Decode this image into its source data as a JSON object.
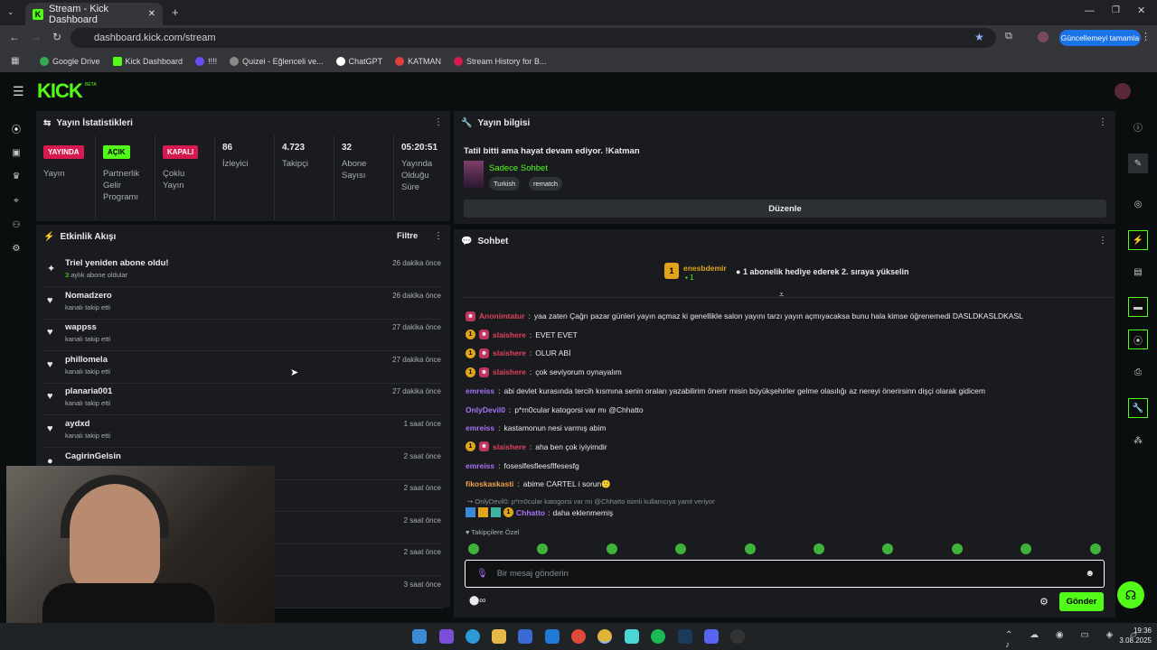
{
  "browser": {
    "tab_title": "Stream - Kick Dashboard",
    "url": "dashboard.kick.com/stream",
    "update_label": "Güncellemeyi tamamla",
    "bookmarks": [
      "Google Drive",
      "Kick Dashboard",
      "!!!!",
      "Quizei - Eğlenceli ve...",
      "ChatGPT",
      "KATMAN",
      "Stream History for B..."
    ]
  },
  "app": {
    "logo": "KICK",
    "beta": "BETA"
  },
  "stats": {
    "title": "Yayın İstatistikleri",
    "items": [
      {
        "badge": "YAYINDA",
        "label": "Yayın"
      },
      {
        "badge": "AÇIK",
        "label": "Partnerlik Gelir Programı"
      },
      {
        "badge": "KAPALI",
        "label": "Çoklu Yayın"
      },
      {
        "value": "86",
        "label": "İzleyici"
      },
      {
        "value": "4.723",
        "label": "Takipçi"
      },
      {
        "value": "32",
        "label": "Abone Sayısı"
      },
      {
        "value": "05:20:51",
        "label": "Yayında Olduğu Süre"
      }
    ]
  },
  "activity": {
    "title": "Etkinlik Akışı",
    "filter": "Filtre",
    "items": [
      {
        "name": "Triel yeniden abone oldu!",
        "sub_num": "3",
        "sub": " aylık abone oldular",
        "time": "26 dakika önce",
        "icon": "✦"
      },
      {
        "name": "Nomadzero",
        "sub": "kanalı takip etti",
        "time": "26 dakika önce",
        "icon": "♥"
      },
      {
        "name": "wappss",
        "sub": "kanalı takip etti",
        "time": "27 dakika önce",
        "icon": "♥"
      },
      {
        "name": "phillomela",
        "sub": "kanalı takip etti",
        "time": "27 dakika önce",
        "icon": "♥"
      },
      {
        "name": "planaria001",
        "sub": "kanalı takip etti",
        "time": "27 dakika önce",
        "icon": "♥"
      },
      {
        "name": "aydxd",
        "sub": "kanalı takip etti",
        "time": "1 saat önce",
        "icon": "♥"
      },
      {
        "name": "CagirinGelsin",
        "sub": "",
        "time": "2 saat önce",
        "icon": "●"
      },
      {
        "name": "",
        "sub": "",
        "time": "2 saat önce",
        "icon": ""
      },
      {
        "name": "",
        "sub": "",
        "time": "2 saat önce",
        "icon": ""
      },
      {
        "name": "",
        "sub": "",
        "time": "2 saat önce",
        "icon": ""
      },
      {
        "name": "",
        "sub": "",
        "time": "3 saat önce",
        "icon": ""
      }
    ]
  },
  "stream_info": {
    "title": "Yayın bilgisi",
    "stream_title": "Tatil bitti ama hayat devam ediyor. !Katman",
    "category": "Sadece Sohbet",
    "tags": [
      "Turkish",
      "rematch"
    ],
    "edit_label": "Düzenle"
  },
  "chat": {
    "title": "Sohbet",
    "pinned_user": "enesbdemir",
    "pinned_count": "1",
    "pinned_rank": "1",
    "pinned_text": "1 abonelik hediye ederek 2. sıraya yükselin",
    "messages": [
      {
        "user": "Anonimtatur",
        "color": "#e0435b",
        "text": "yaa zaten Çağrı pazar günleri yayın açmaz ki genellikle salon yayını tarzı yayın açmıyacaksa bunu hala kimse öğrenemedi DASLDKASLDKASL",
        "badges": [
          "sub"
        ]
      },
      {
        "user": "slaishere",
        "color": "#e0435b",
        "text": "EVET EVET",
        "badges": [
          "gift",
          "sub"
        ]
      },
      {
        "user": "slaishere",
        "color": "#e0435b",
        "text": "OLUR ABİ",
        "badges": [
          "gift",
          "sub"
        ]
      },
      {
        "user": "slaishere",
        "color": "#e0435b",
        "text": "çok seviyorum oynayalım",
        "badges": [
          "gift",
          "sub"
        ]
      },
      {
        "user": "emreiss",
        "color": "#a971f5",
        "text": "abi devlet kurasında tercih kısmına senin oraları yazabilirim önerir misin büyükşehirler gelme olasılığı az nereyi önerirsinn dişçi olarak gidicem",
        "badges": []
      },
      {
        "user": "OnlyDevil0",
        "color": "#a971f5",
        "text": "p*rn0cular katogorsi var mı @Chhatto",
        "badges": []
      },
      {
        "user": "emreiss",
        "color": "#a971f5",
        "text": "kastamonun nesi varmış abim",
        "badges": []
      },
      {
        "user": "slaishere",
        "color": "#e0435b",
        "text": "aha ben çok iyiyimdir",
        "badges": [
          "gift",
          "sub"
        ]
      },
      {
        "user": "emreiss",
        "color": "#a971f5",
        "text": "foseslfesfleesflfesesfg",
        "badges": []
      },
      {
        "user": "fikoskaskasti",
        "color": "#f0a24a",
        "text": "abime CARTEL i sorun🙂",
        "badges": []
      }
    ],
    "reply_text": "OnlyDevil0: p*rn0cular katogorsi var mı @Chhatto isimli kullanıcıya yanıt veriyor",
    "reply_user": "Chhatto",
    "reply_msg": "daha eklenmemiş",
    "emote_label": "Takipçilere Özel",
    "input_placeholder": "Bir mesaj gönderin",
    "send_label": "Gönder"
  },
  "taskbar": {
    "time": "19:36",
    "date": "3.08.2025"
  },
  "colors": {
    "accent": "#53fc18",
    "live": "#d6194e",
    "panel": "#191b1f"
  }
}
